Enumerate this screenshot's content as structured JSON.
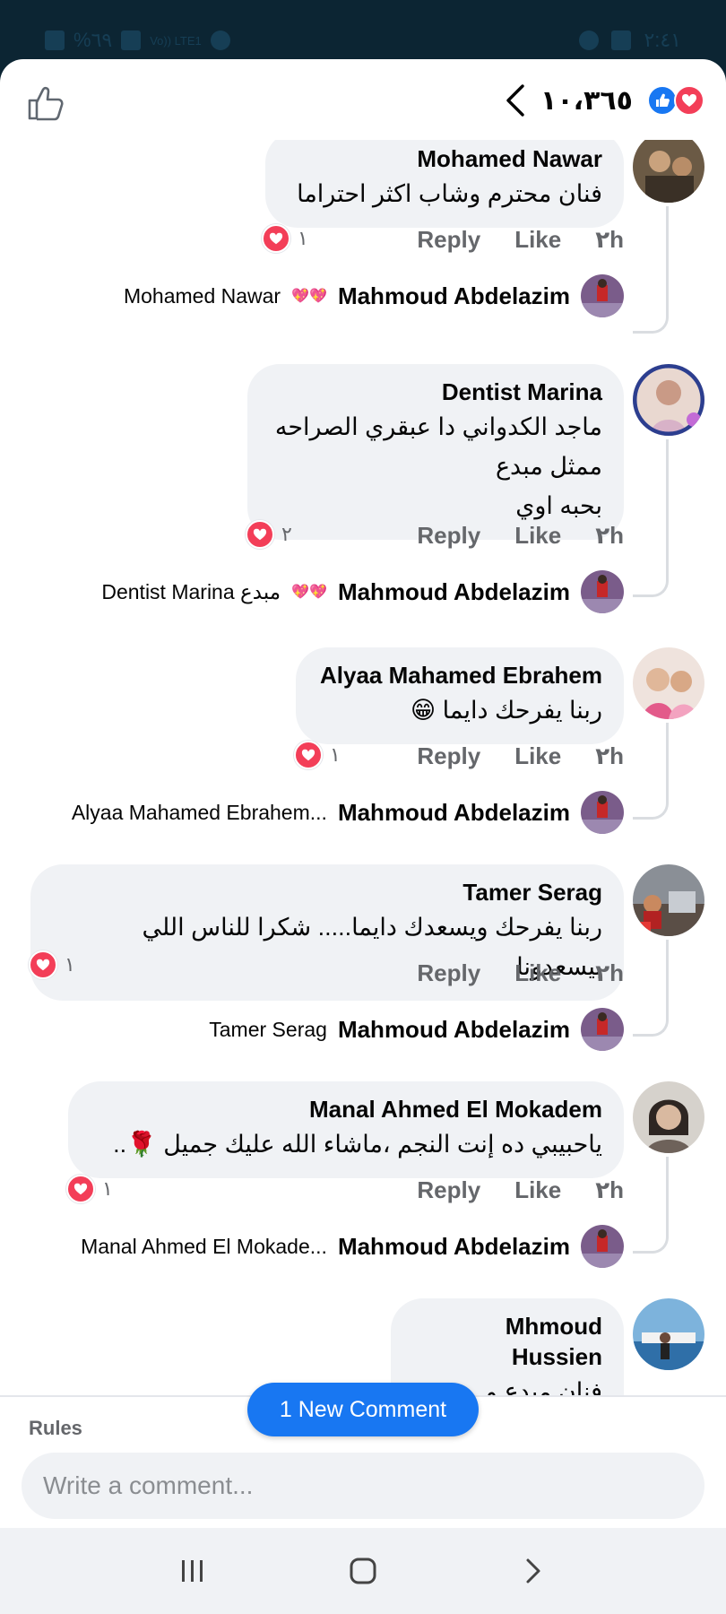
{
  "status": {
    "battery": "%٦٩",
    "carrier": "Vo)) LTE1",
    "time": "٢:٤١"
  },
  "header": {
    "reaction_count": "١٠،٣٦٥"
  },
  "comments": [
    {
      "name": "Mohamed Nawar",
      "text_lines": [
        "فنان محترم وشاب اكثر احتراما"
      ],
      "time": "٢h",
      "like": "Like",
      "reply": "Reply",
      "reactions": "١",
      "reply_author": "Mahmoud Abdelazim",
      "reply_text": "Mohamed Nawar"
    },
    {
      "name": "Dentist Marina",
      "text_lines": [
        "ماجد الكدواني دا عبقري الصراحه",
        "ممثل مبدع",
        "بحبه اوي"
      ],
      "time": "٢h",
      "like": "Like",
      "reply": "Reply",
      "reactions": "٢",
      "reply_author": "Mahmoud Abdelazim",
      "reply_text": "Dentist Marina مبدع"
    },
    {
      "name": "Alyaa Mahamed Ebrahem",
      "text_lines": [
        "ربنا يفرحك دايما 😁"
      ],
      "time": "٢h",
      "like": "Like",
      "reply": "Reply",
      "reactions": "١",
      "reply_author": "Mahmoud Abdelazim",
      "reply_text": "Alyaa Mahamed Ebrahem..."
    },
    {
      "name": "Tamer Serag",
      "text_lines": [
        "ربنا يفرحك ويسعدك دايما..... شكرا للناس اللي بيسعدونا"
      ],
      "time": "٢h",
      "like": "Like",
      "reply": "Reply",
      "reactions": "١",
      "reply_author": "Mahmoud Abdelazim",
      "reply_text": "Tamer Serag"
    },
    {
      "name": "Manal Ahmed El Mokadem",
      "text_lines": [
        "ياحبيبي ده إنت النجم ،ماشاء الله عليك جميل 🌹.."
      ],
      "time": "٢h",
      "like": "Like",
      "reply": "Reply",
      "reactions": "١",
      "reply_author": "Mahmoud Abdelazim",
      "reply_text": "Manal Ahmed El Mokade..."
    },
    {
      "name": "Mhmoud Hussien",
      "text_lines": [
        "فنان مبدع و"
      ]
    }
  ],
  "new_comment_label": "1 New Comment",
  "composer": {
    "rules_label": "Rules",
    "placeholder": "Write a comment..."
  },
  "colors": {
    "accent": "#1877f2",
    "love": "#f33e58",
    "bubble": "#f0f2f5"
  }
}
